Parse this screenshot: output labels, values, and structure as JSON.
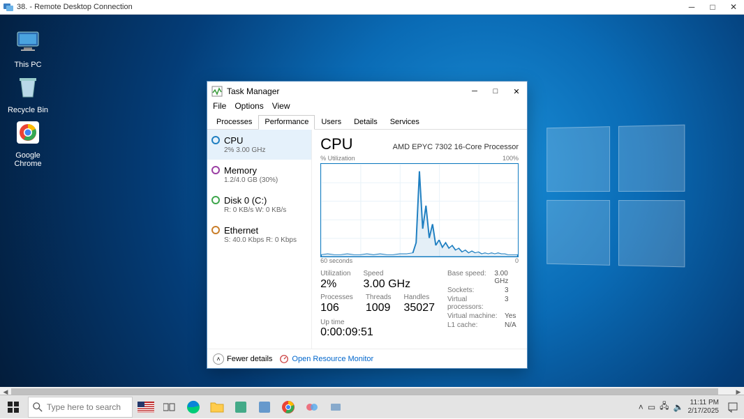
{
  "rdc": {
    "title": "38.     - Remote Desktop Connection"
  },
  "desktop_icons": {
    "thispc": "This PC",
    "recycle": "Recycle Bin",
    "chrome": "Google Chrome"
  },
  "taskmgr": {
    "title": "Task Manager",
    "menu": [
      "File",
      "Options",
      "View"
    ],
    "tabs": [
      "Processes",
      "Performance",
      "Users",
      "Details",
      "Services"
    ],
    "sidebar": [
      {
        "name": "CPU",
        "sub": "2% 3.00 GHz",
        "color": "#1f7fc1"
      },
      {
        "name": "Memory",
        "sub": "1.2/4.0 GB (30%)",
        "color": "#9b3fa3"
      },
      {
        "name": "Disk 0 (C:)",
        "sub": "R: 0 KB/s W: 0 KB/s",
        "color": "#3ea64c"
      },
      {
        "name": "Ethernet",
        "sub": "S: 40.0 Kbps R: 0 Kbps",
        "color": "#c97e2a"
      }
    ],
    "header_big": "CPU",
    "header_proc": "AMD EPYC 7302 16-Core Processor",
    "chart_top_left": "% Utilization",
    "chart_top_right": "100%",
    "chart_bottom_left": "60 seconds",
    "chart_bottom_right": "0",
    "stats_a": [
      {
        "lbl": "Utilization",
        "val": "2%"
      },
      {
        "lbl": "Speed",
        "val": "3.00 GHz"
      }
    ],
    "stats_b": [
      {
        "lbl": "Processes",
        "val": "106"
      },
      {
        "lbl": "Threads",
        "val": "1009"
      },
      {
        "lbl": "Handles",
        "val": "35027"
      }
    ],
    "stats_right": [
      {
        "k": "Base speed:",
        "v": "3.00 GHz"
      },
      {
        "k": "Sockets:",
        "v": "3"
      },
      {
        "k": "Virtual processors:",
        "v": "3"
      },
      {
        "k": "Virtual machine:",
        "v": "Yes"
      },
      {
        "k": "L1 cache:",
        "v": "N/A"
      }
    ],
    "uptime_lbl": "Up time",
    "uptime_val": "0:00:09:51",
    "fewer": "Fewer details",
    "orm": "Open Resource Monitor"
  },
  "taskbar": {
    "search_placeholder": "Type here to search",
    "time": "11:11 PM",
    "date": "2/17/2025"
  },
  "chart_data": {
    "type": "line",
    "title": "% Utilization",
    "xlabel": "60 seconds → 0",
    "ylabel": "% Utilization",
    "ylim": [
      0,
      100
    ],
    "xlim": [
      60,
      0
    ],
    "note": "x is seconds ago (60 at left, 0 at right); y is CPU % (100 at top)",
    "series": [
      {
        "name": "CPU",
        "points": [
          [
            60,
            2
          ],
          [
            58,
            3
          ],
          [
            56,
            2
          ],
          [
            54,
            2
          ],
          [
            52,
            3
          ],
          [
            50,
            2
          ],
          [
            48,
            2
          ],
          [
            46,
            3
          ],
          [
            44,
            2
          ],
          [
            42,
            3
          ],
          [
            40,
            2
          ],
          [
            38,
            2
          ],
          [
            36,
            3
          ],
          [
            34,
            3
          ],
          [
            32,
            4
          ],
          [
            31,
            15
          ],
          [
            30,
            92
          ],
          [
            29,
            30
          ],
          [
            28,
            55
          ],
          [
            27,
            20
          ],
          [
            26,
            35
          ],
          [
            25,
            12
          ],
          [
            24,
            18
          ],
          [
            23,
            10
          ],
          [
            22,
            15
          ],
          [
            21,
            9
          ],
          [
            20,
            12
          ],
          [
            19,
            7
          ],
          [
            18,
            9
          ],
          [
            17,
            5
          ],
          [
            16,
            7
          ],
          [
            15,
            4
          ],
          [
            14,
            6
          ],
          [
            13,
            4
          ],
          [
            12,
            5
          ],
          [
            11,
            3
          ],
          [
            10,
            4
          ],
          [
            9,
            3
          ],
          [
            8,
            4
          ],
          [
            7,
            3
          ],
          [
            6,
            4
          ],
          [
            5,
            3
          ],
          [
            4,
            3
          ],
          [
            3,
            2
          ],
          [
            2,
            2
          ],
          [
            1,
            2
          ],
          [
            0,
            2
          ]
        ]
      }
    ]
  }
}
